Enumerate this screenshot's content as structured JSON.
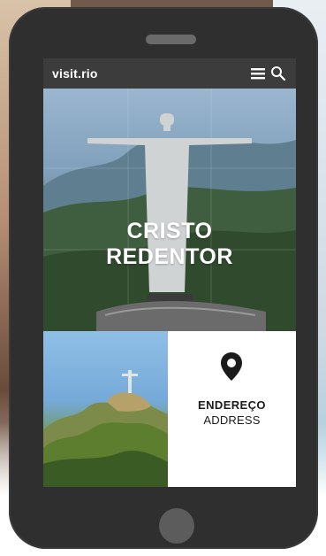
{
  "app": {
    "logo_text": "visit.rio"
  },
  "header": {
    "menu_icon": "hamburger-menu-icon",
    "search_icon": "search-icon"
  },
  "hero": {
    "title_line1": "CRISTO",
    "title_line2": "REDENTOR"
  },
  "address_card": {
    "icon": "location-pin-icon",
    "title": "ENDEREÇO",
    "subtitle": "ADDRESS"
  },
  "colors": {
    "topbar": "#3c3c3c",
    "phone_body": "#2f2f2f",
    "screen_text": "#ffffff",
    "card_text": "#1c1c1c"
  }
}
